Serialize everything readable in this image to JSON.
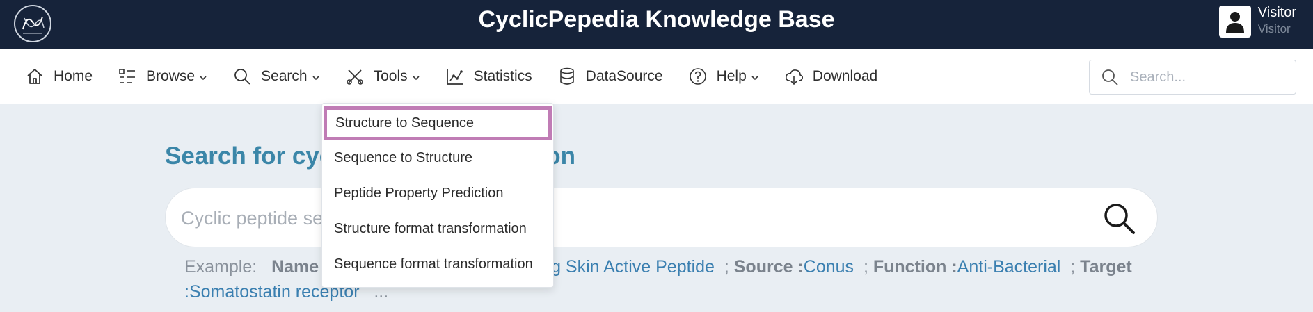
{
  "header": {
    "title": "CyclicPepedia Knowledge Base",
    "user_name": "Visitor",
    "user_role": "Visitor"
  },
  "nav": {
    "items": [
      {
        "label": "Home",
        "icon": "home-icon",
        "has_dropdown": false
      },
      {
        "label": "Browse",
        "icon": "list-icon",
        "has_dropdown": true
      },
      {
        "label": "Search",
        "icon": "search-icon",
        "has_dropdown": true
      },
      {
        "label": "Tools",
        "icon": "tools-icon",
        "has_dropdown": true
      },
      {
        "label": "Statistics",
        "icon": "chart-icon",
        "has_dropdown": false
      },
      {
        "label": "DataSource",
        "icon": "database-icon",
        "has_dropdown": false
      },
      {
        "label": "Help",
        "icon": "help-icon",
        "has_dropdown": true
      },
      {
        "label": "Download",
        "icon": "cloud-download-icon",
        "has_dropdown": false
      }
    ],
    "search_placeholder": "Search..."
  },
  "tools_menu": {
    "items": [
      "Structure to Sequence",
      "Sequence to Structure",
      "Peptide Property Prediction",
      "Structure format transformation",
      "Sequence format transformation"
    ]
  },
  "main": {
    "title_visible": "Search for cyc",
    "title_visible_end": "on",
    "search_placeholder_visible": "Cyclic peptide se",
    "example_label": "Example:",
    "example_name_key": "Name",
    "example_name_value_visible": "g Skin Active Peptide",
    "example_source_key": "Source :",
    "example_source_value": "Conus",
    "example_function_key": "Function :",
    "example_function_value": "Anti-Bacterial",
    "example_target_key": "Target",
    "example_target_value": ":Somatostatin receptor",
    "example_more": "..."
  },
  "colors": {
    "topbar": "#16233a",
    "accent": "#3b86a8",
    "highlight_border": "#c07cb5"
  }
}
